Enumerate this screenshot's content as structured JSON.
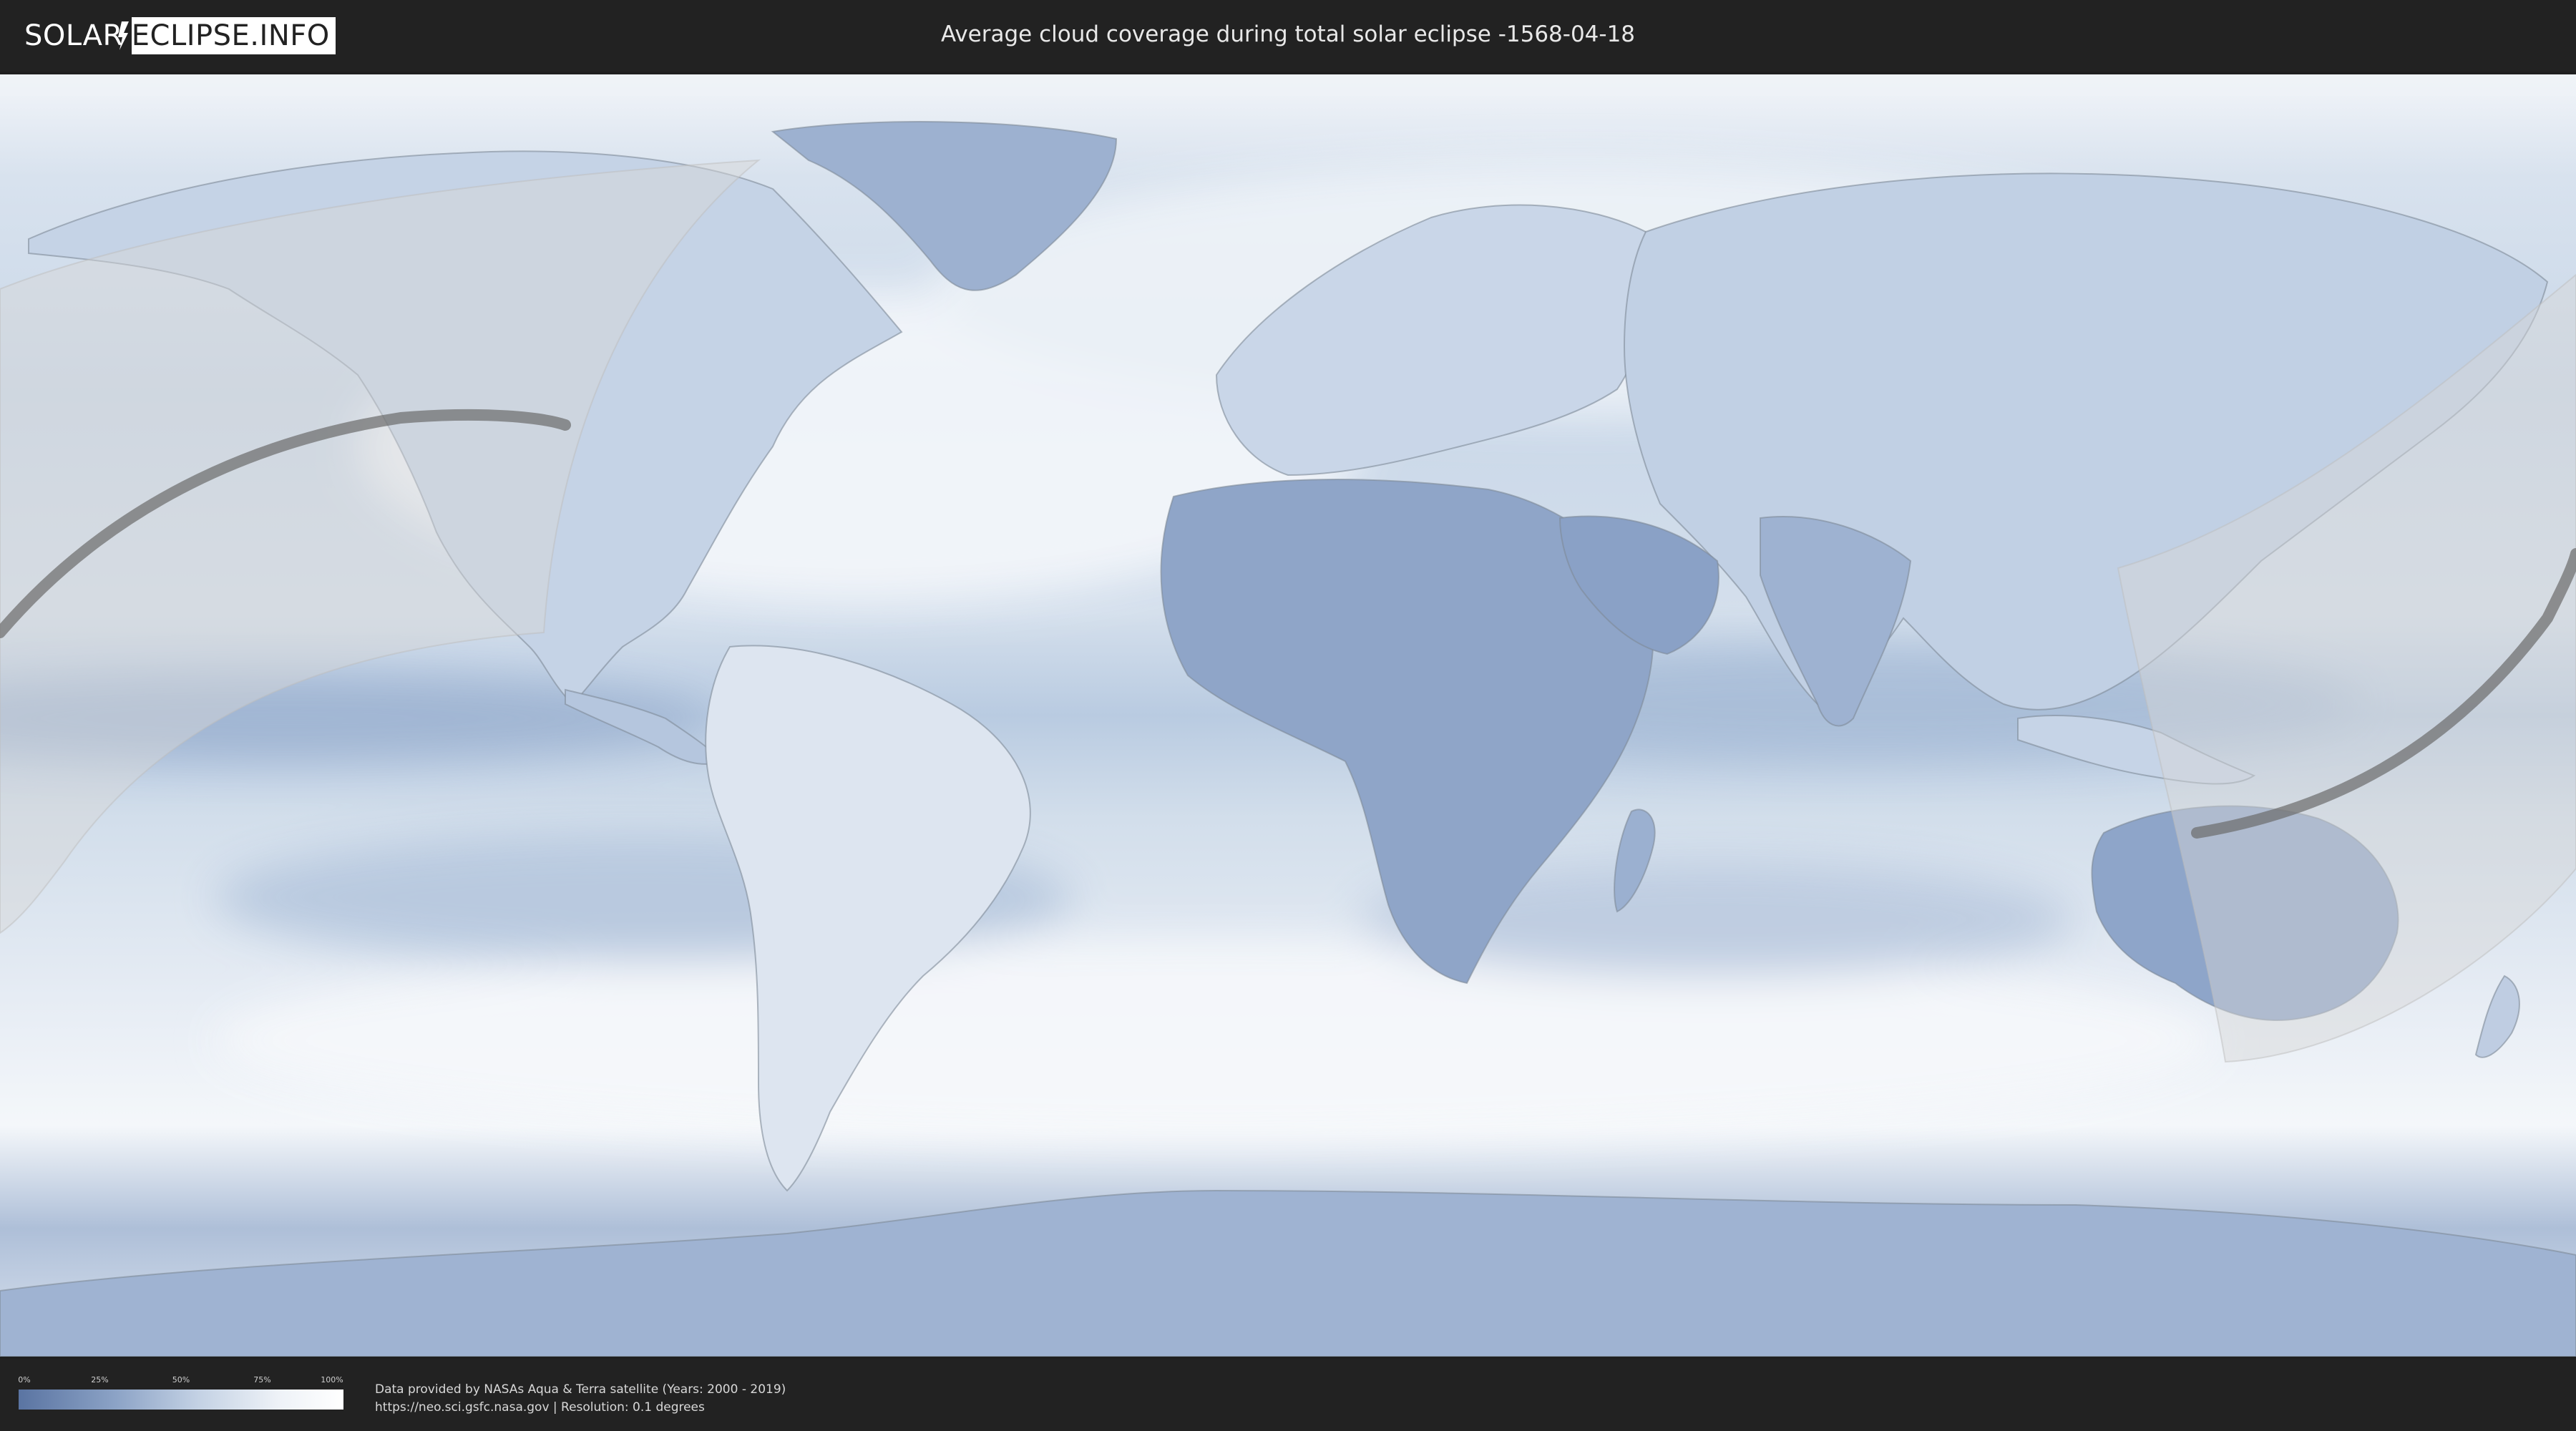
{
  "header": {
    "logo_left": "SOLAR",
    "logo_right": "ECLIPSE.INFO",
    "title": "Average cloud coverage during total solar eclipse -1568-04-18"
  },
  "map": {
    "eclipse_date": "-1568-04-18",
    "colors": {
      "clear": "#5a74a2",
      "cloudy": "#ffffff",
      "land_border": "#7f8a98",
      "visibility_overlay": "#d9d9d9",
      "totality_path": "#6b6b6b"
    }
  },
  "legend": {
    "ticks": [
      "0%",
      "25%",
      "50%",
      "75%",
      "100%"
    ],
    "tick_fractions": [
      0,
      0.25,
      0.5,
      0.75,
      1.0
    ]
  },
  "credits": {
    "line1": "Data provided by NASAs Aqua & Terra satellite (Years: 2000 - 2019)",
    "line2": "https://neo.sci.gsfc.nasa.gov | Resolution: 0.1 degrees"
  }
}
